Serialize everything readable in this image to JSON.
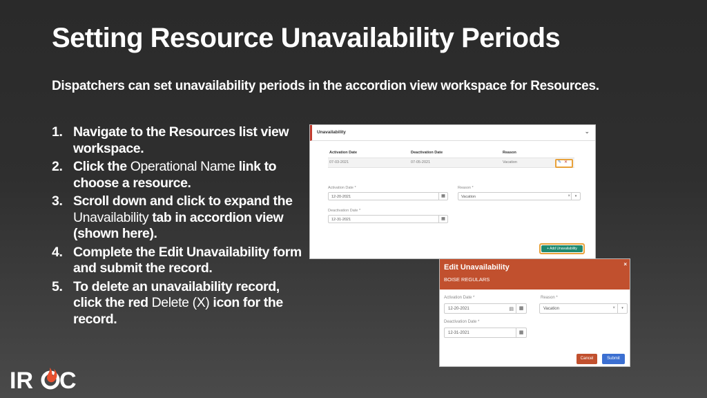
{
  "slide": {
    "title": "Setting Resource Unavailability Periods",
    "subtitle": "Dispatchers can set unavailability periods in the accordion view workspace for Resources."
  },
  "steps": [
    {
      "num": "1.",
      "parts": [
        "Navigate to the Resources list view workspace."
      ]
    },
    {
      "num": "2.",
      "a": "Click the ",
      "b": "Operational Name",
      "c": " link to choose a resource."
    },
    {
      "num": "3.",
      "a": "Scroll down and click to expand the ",
      "b": "Unavailability",
      "c": " tab in accordion view (shown here)."
    },
    {
      "num": "4.",
      "a": "Complete the Edit Unavailability form and submit the record."
    },
    {
      "num": "5.",
      "a": "To delete an unavailability record, click the red ",
      "b": "Delete (X)",
      "c": " icon for the record."
    }
  ],
  "accordion": {
    "title": "Unavailability",
    "columns": [
      "Activation Date",
      "Deactivation Date",
      "Reason"
    ],
    "row": [
      "07-03-2021",
      "07-05-2021",
      "Vacation"
    ],
    "activation_label": "Activation Date *",
    "activation_value": "12-20-2021",
    "deactivation_label": "Deactivation Date *",
    "deactivation_value": "12-31-2021",
    "reason_label": "Reason *",
    "reason_value": "Vacation",
    "add_button": "+ Add Unavailability"
  },
  "modal": {
    "title": "Edit Unavailability",
    "subtitle": "BOISE REGULARS",
    "activation_label": "Activation Date *",
    "activation_value": "12-20-2021",
    "deactivation_label": "Deactivation Date *",
    "deactivation_value": "12-31-2021",
    "reason_label": "Reason *",
    "reason_value": "Vacation",
    "cancel": "Cancel",
    "submit": "Submit"
  },
  "logo": {
    "text": "IROC"
  },
  "icons": {
    "calendar": "calendar-icon",
    "close": "close-icon",
    "edit": "edit-icon",
    "delete": "delete-icon",
    "chevron": "chevron-down-icon"
  },
  "colors": {
    "accent": "#c1502e",
    "highlight": "#e8a13a",
    "add_button": "#1f8a70",
    "submit": "#3b6fd1"
  }
}
